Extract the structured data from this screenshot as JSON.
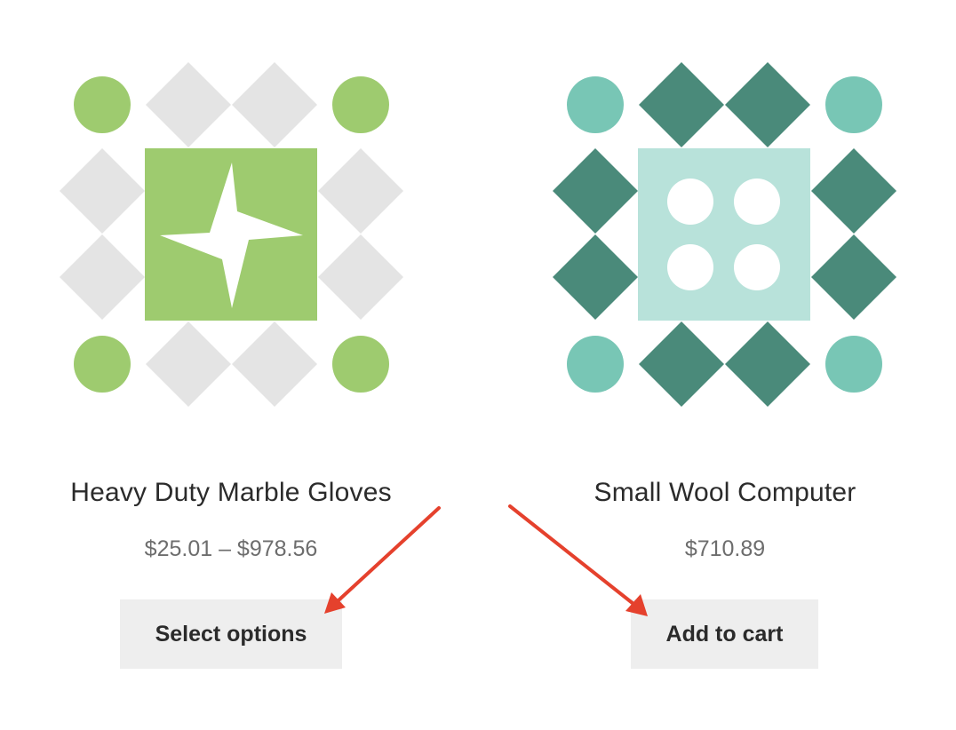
{
  "products": [
    {
      "name": "Heavy Duty Marble Gloves",
      "price": "$25.01 – $978.56",
      "button_label": "Select options",
      "image_colors": {
        "circle": "#9ecb6f",
        "diamond": "#e4e4e4",
        "center": "#9ecb6f",
        "motif": "#ffffff"
      },
      "image_motif": "four-point-star-icon"
    },
    {
      "name": "Small Wool Computer",
      "price": "$710.89",
      "button_label": "Add to cart",
      "image_colors": {
        "circle": "#78c6b5",
        "diamond": "#4a8a7a",
        "center": "#b8e2da",
        "motif": "#ffffff"
      },
      "image_motif": "four-dots-icon"
    }
  ],
  "colors": {
    "annotation_arrow": "#e5412d",
    "button_bg": "#eeeeee"
  }
}
